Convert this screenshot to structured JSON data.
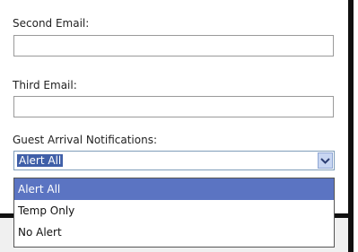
{
  "form": {
    "second_email": {
      "label": "Second Email:",
      "value": ""
    },
    "third_email": {
      "label": "Third Email:",
      "value": ""
    },
    "guest_arrival": {
      "label": "Guest Arrival Notifications:",
      "selected": "Alert All",
      "options": [
        "Alert All",
        "Temp Only",
        "No Alert"
      ]
    }
  },
  "colors": {
    "selection": "#3f5fa8",
    "highlight": "#5b74c2",
    "select_border": "#7f9db9"
  },
  "icons": {
    "dropdown": "chevron-down-icon"
  }
}
